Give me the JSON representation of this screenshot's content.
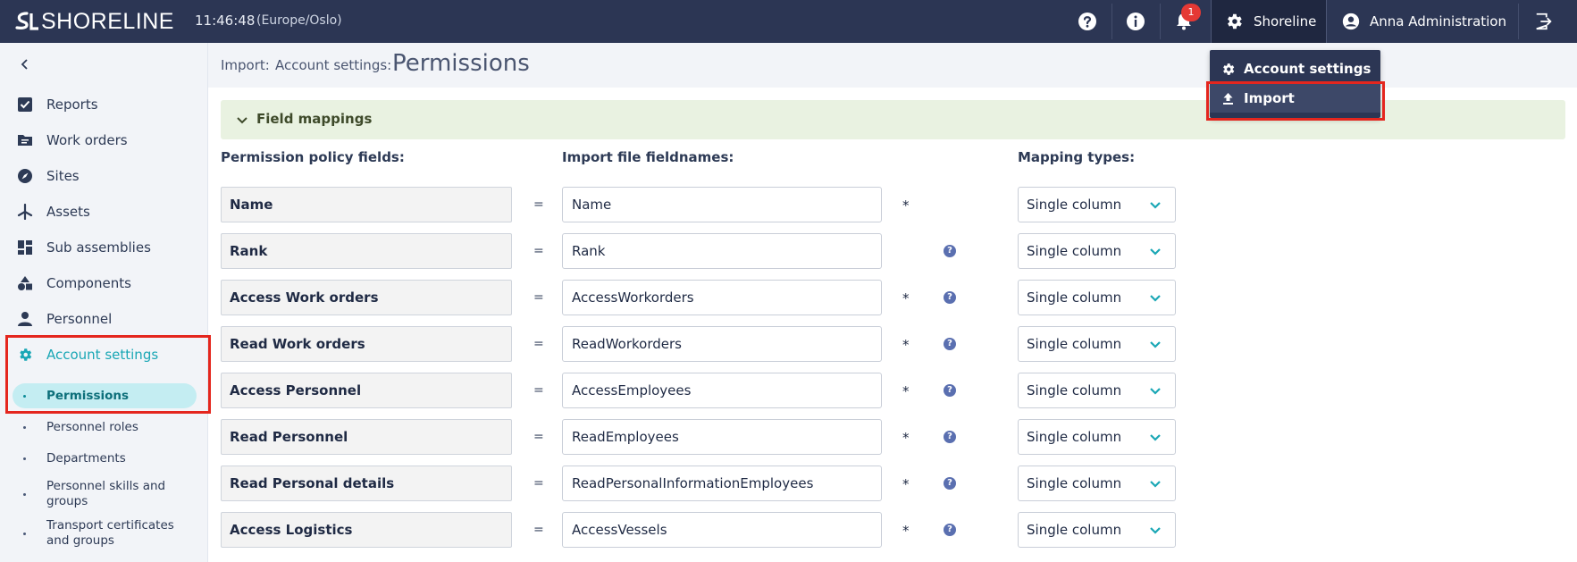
{
  "app": {
    "brand": "SHORELINE",
    "clock": "11:46:48",
    "timezone": "(Europe/Oslo)",
    "notification_count": "1",
    "account_button_label": "Shoreline",
    "user_label": "Anna Administration",
    "icons": [
      "help-icon",
      "info-icon",
      "bell-icon",
      "gear-icon",
      "user-icon",
      "logout-icon"
    ]
  },
  "account_menu": {
    "items": [
      {
        "label": "Account settings",
        "icon": "gear-icon"
      },
      {
        "label": "Import",
        "icon": "upload-icon"
      }
    ]
  },
  "sidebar": {
    "items": [
      {
        "label": "Reports",
        "icon": "checkbox-icon"
      },
      {
        "label": "Work orders",
        "icon": "folder-icon"
      },
      {
        "label": "Sites",
        "icon": "compass-icon"
      },
      {
        "label": "Assets",
        "icon": "turbine-icon"
      },
      {
        "label": "Sub assemblies",
        "icon": "dashboard-icon"
      },
      {
        "label": "Components",
        "icon": "shapes-icon"
      },
      {
        "label": "Personnel",
        "icon": "person-icon"
      },
      {
        "label": "Account settings",
        "icon": "gear-icon"
      }
    ],
    "sub_items": [
      {
        "label": "Permissions"
      },
      {
        "label": "Personnel roles"
      },
      {
        "label": "Departments"
      },
      {
        "label": "Personnel skills and groups"
      },
      {
        "label": "Transport certificates and groups"
      }
    ],
    "accent_color": "#1aa7b5"
  },
  "breadcrumb": {
    "parts": [
      "Import:",
      "Account settings:"
    ],
    "title": "Permissions"
  },
  "field_mappings": {
    "panel_label": "Field mappings",
    "headers": {
      "policy": "Permission policy fields:",
      "import": "Import file fieldnames:",
      "mapping": "Mapping types:"
    },
    "equals": "=",
    "required_mark": "*",
    "help_mark": "?",
    "rows": [
      {
        "field": "Name",
        "value": "Name",
        "required": true,
        "help": false,
        "mapping": "Single column"
      },
      {
        "field": "Rank",
        "value": "Rank",
        "required": false,
        "help": true,
        "mapping": "Single column"
      },
      {
        "field": "Access Work orders",
        "value": "AccessWorkorders",
        "required": true,
        "help": true,
        "mapping": "Single column"
      },
      {
        "field": "Read Work orders",
        "value": "ReadWorkorders",
        "required": true,
        "help": true,
        "mapping": "Single column"
      },
      {
        "field": "Access Personnel",
        "value": "AccessEmployees",
        "required": true,
        "help": true,
        "mapping": "Single column"
      },
      {
        "field": "Read Personnel",
        "value": "ReadEmployees",
        "required": true,
        "help": true,
        "mapping": "Single column"
      },
      {
        "field": "Read Personal details",
        "value": "ReadPersonalInformationEmployees",
        "required": true,
        "help": true,
        "mapping": "Single column"
      },
      {
        "field": "Access Logistics",
        "value": "AccessVessels",
        "required": true,
        "help": true,
        "mapping": "Single column"
      }
    ]
  }
}
